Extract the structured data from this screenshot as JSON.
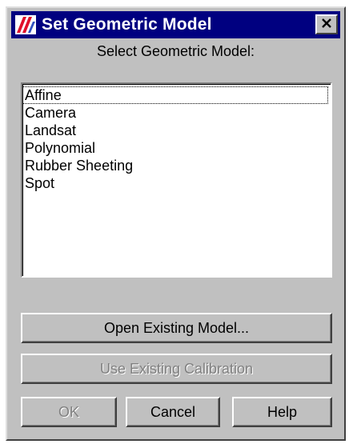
{
  "window": {
    "title": "Set Geometric Model",
    "close_icon": "close-icon",
    "app_icon": "app-logo-icon"
  },
  "prompt": "Select Geometric Model:",
  "models": [
    "Affine",
    "Camera",
    "Landsat",
    "Polynomial",
    "Rubber Sheeting",
    "Spot"
  ],
  "focused_model": "Affine",
  "buttons": {
    "open_existing": "Open Existing Model...",
    "use_existing": "Use Existing Calibration",
    "ok": "OK",
    "cancel": "Cancel",
    "help": "Help"
  },
  "colors": {
    "titlebar": "#000080",
    "face": "#c0c0c0",
    "disabled_text": "#808080"
  }
}
